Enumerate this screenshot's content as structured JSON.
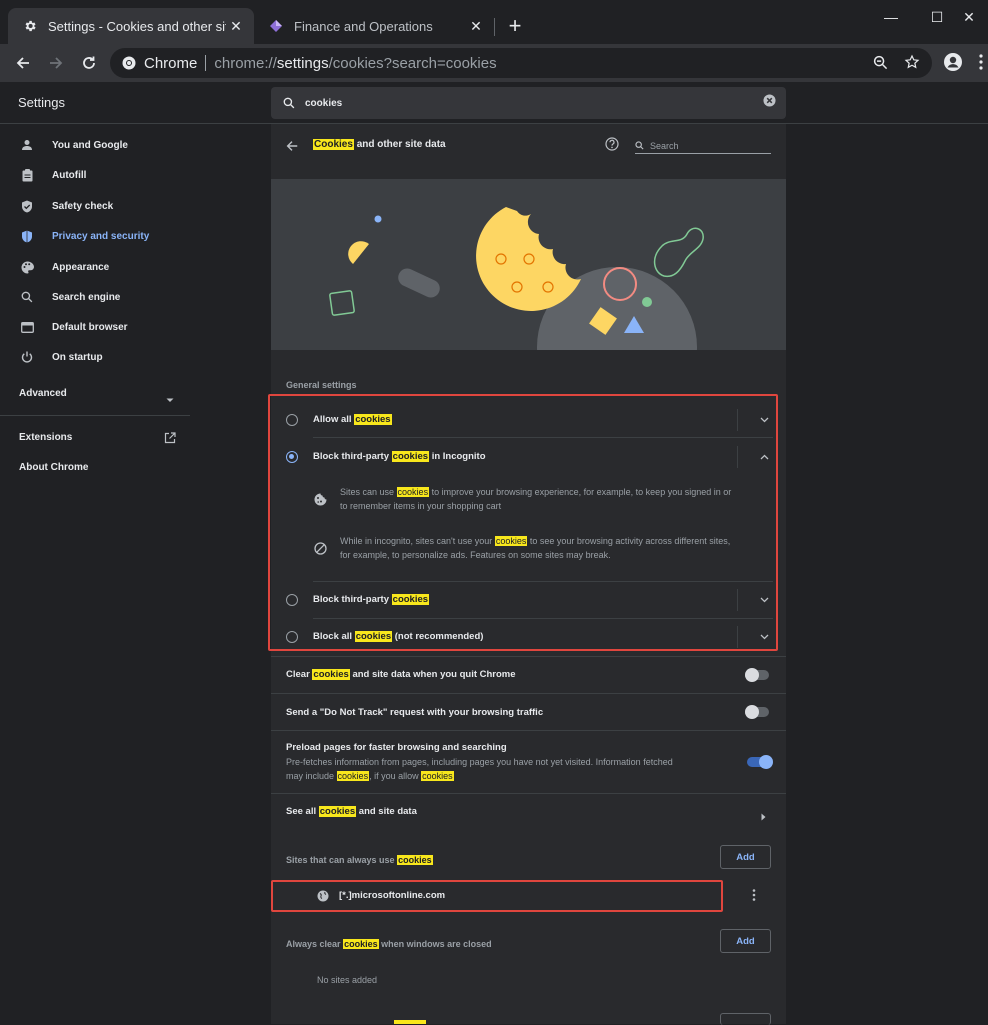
{
  "tabs": [
    {
      "label": "Settings - Cookies and other site",
      "active": true
    },
    {
      "label": "Finance and Operations",
      "active": false
    }
  ],
  "omnibox": {
    "site_label": "Chrome",
    "url_prefix": "chrome://",
    "url_bold": "settings",
    "url_suffix": "/cookies?search=cookies"
  },
  "settings_title": "Settings",
  "search": {
    "value": "cookies"
  },
  "sidebar": {
    "items": [
      {
        "label": "You and Google",
        "icon": "person-icon"
      },
      {
        "label": "Autofill",
        "icon": "clipboard-icon"
      },
      {
        "label": "Safety check",
        "icon": "shield-check-icon"
      },
      {
        "label": "Privacy and security",
        "icon": "shield-icon",
        "active": true
      },
      {
        "label": "Appearance",
        "icon": "palette-icon"
      },
      {
        "label": "Search engine",
        "icon": "search-icon"
      },
      {
        "label": "Default browser",
        "icon": "browser-icon"
      },
      {
        "label": "On startup",
        "icon": "power-icon"
      }
    ],
    "advanced": "Advanced",
    "extensions": "Extensions",
    "about": "About Chrome"
  },
  "page": {
    "title_hl": "Cookies",
    "title_rest": "and other site data",
    "search_placeholder": "Search"
  },
  "general": {
    "label": "General settings",
    "options": [
      {
        "pre": "Allow all",
        "hl": "cookies",
        "post": ""
      },
      {
        "pre": "Block third-party",
        "hl": "cookies",
        "post": "in Incognito",
        "selected": true
      },
      {
        "pre": "Block third-party",
        "hl": "cookies",
        "post": ""
      },
      {
        "pre": "Block all",
        "hl": "cookies",
        "post": "(not recommended)"
      }
    ],
    "details": [
      {
        "l1a": "Sites can use",
        "l1hl": "cookies",
        "l1b": "to improve your browsing experience, for example, to keep you signed in or",
        "l2": "to remember items in your shopping cart"
      },
      {
        "l1a": "While in incognito, sites can't use your",
        "l1hl": "cookies",
        "l1b": "to see your browsing activity across different sites,",
        "l2": "for example, to personalize ads. Features on some sites may break."
      }
    ]
  },
  "toggles": {
    "clear_pre": "Clear",
    "clear_hl": "cookies",
    "clear_post": "and site data when you quit Chrome",
    "dnt": "Send a \"Do Not Track\" request with your browsing traffic",
    "preload_title": "Preload pages for faster browsing and searching",
    "preload_sub1": "Pre-fetches information from pages, including pages you have not yet visited. Information fetched",
    "preload_sub2a": "may include",
    "preload_sub2hl": "cookies",
    "preload_sub2b": ", if you allow",
    "preload_sub2hl2": "cookies"
  },
  "see_all": {
    "pre": "See all",
    "hl": "cookies",
    "post": "and site data"
  },
  "always_use": {
    "pre": "Sites that can always use",
    "hl": "cookies",
    "add": "Add",
    "site": "[*.]microsoftonline.com"
  },
  "always_clear": {
    "pre": "Always clear",
    "hl": "cookies",
    "post": "when windows are closed",
    "add": "Add",
    "empty": "No sites added"
  },
  "colors": {
    "accent": "#8ab4f8",
    "highlight": "#f8e71c",
    "red_box": "#e0463e"
  }
}
